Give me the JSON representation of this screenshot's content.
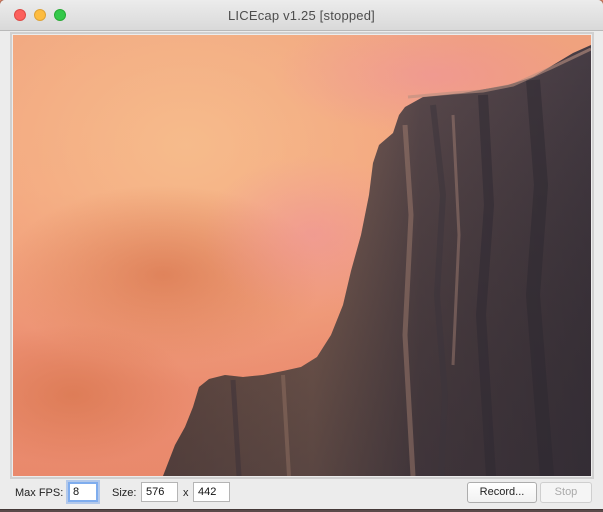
{
  "window": {
    "title": "LICEcap v1.25 [stopped]"
  },
  "controls": {
    "max_fps_label": "Max FPS:",
    "max_fps_value": "8",
    "size_label": "Size:",
    "width_value": "576",
    "x_separator": "x",
    "height_value": "442",
    "record_label": "Record...",
    "stop_label": "Stop"
  },
  "colors": {
    "close": "#fc605c",
    "minimize": "#fdbc40",
    "maximize": "#34c84a",
    "focus_ring": "#7fadee"
  },
  "icons": {
    "close": "close-icon",
    "minimize": "minimize-icon",
    "maximize": "maximize-icon"
  }
}
